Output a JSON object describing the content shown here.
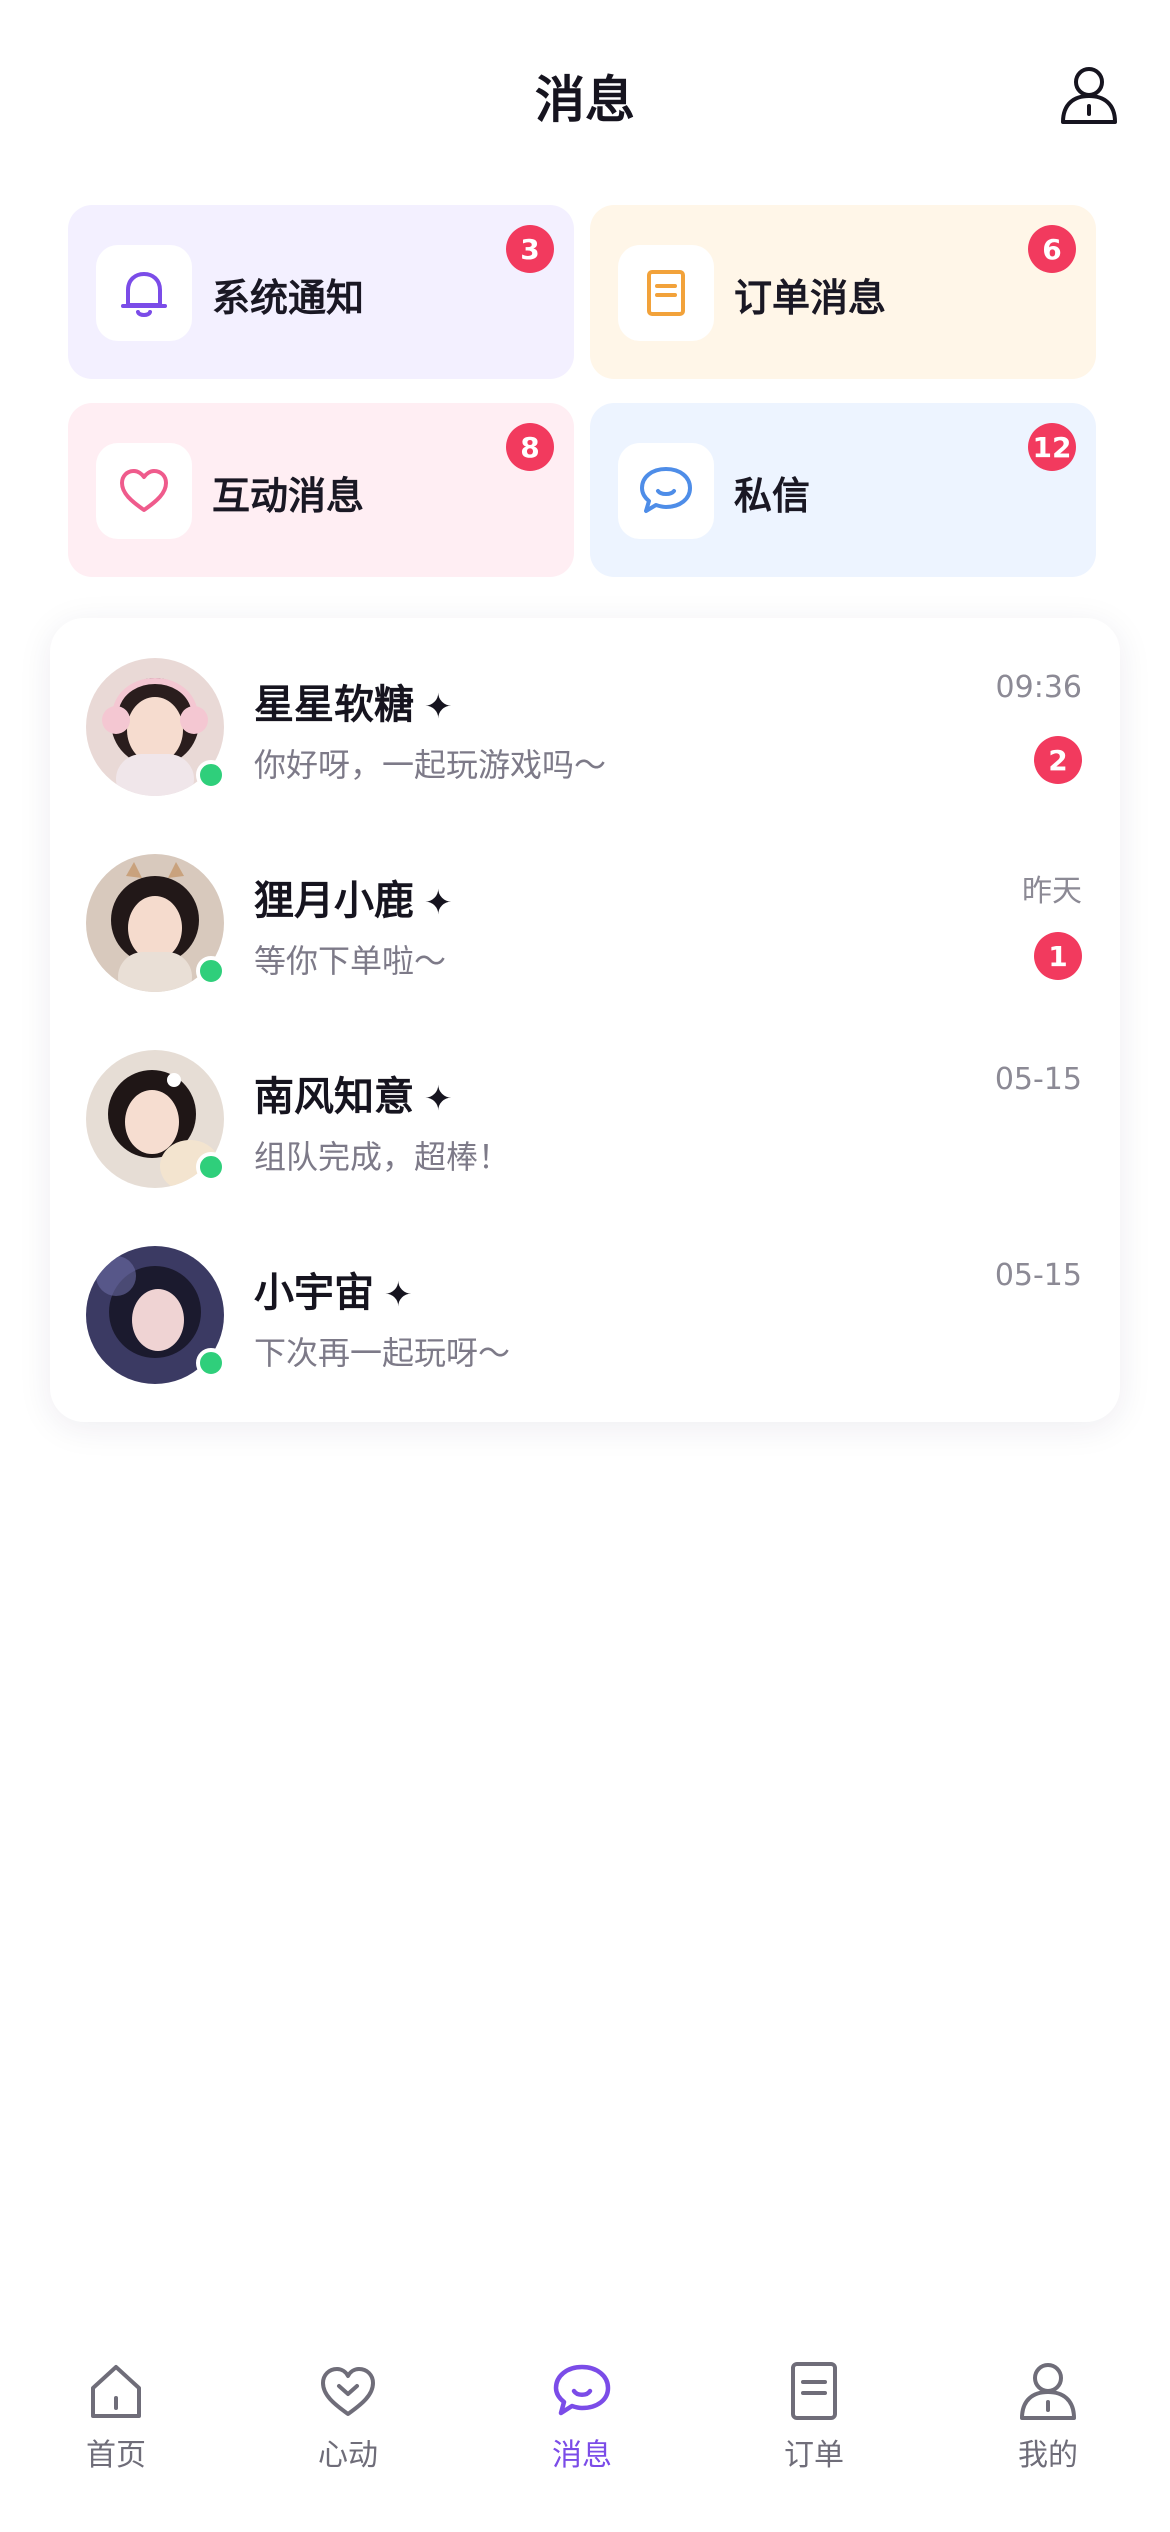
{
  "header": {
    "title": "消息",
    "profile_icon": "user-outline-icon"
  },
  "categories": [
    {
      "label": "系统通知",
      "badge": "3",
      "icon": "bell-icon",
      "bg": "#f3f0ff",
      "color": "#7b4ce8"
    },
    {
      "label": "订单消息",
      "badge": "6",
      "icon": "document-icon",
      "bg": "#fff6e8",
      "color": "#f2a23a"
    },
    {
      "label": "互动消息",
      "badge": "8",
      "icon": "heart-icon",
      "bg": "#ffeef3",
      "color": "#ef5b8c"
    },
    {
      "label": "私信",
      "badge": "12",
      "icon": "chat-bubble-icon",
      "bg": "#edf4ff",
      "color": "#4e8de8"
    }
  ],
  "conversations": [
    {
      "name": "星星软糖",
      "sparkle": "✦",
      "preview": "你好呀，一起玩游戏吗～",
      "time": "09:36",
      "unread": "2",
      "online": true
    },
    {
      "name": "狸月小鹿",
      "sparkle": "✦",
      "preview": "等你下单啦～",
      "time": "昨天",
      "unread": "1",
      "online": true
    },
    {
      "name": "南风知意",
      "sparkle": "✦",
      "preview": "组队完成，超棒！",
      "time": "05-15",
      "unread": "",
      "online": true
    },
    {
      "name": "小宇宙",
      "sparkle": "✦",
      "preview": "下次再一起玩呀～",
      "time": "05-15",
      "unread": "",
      "online": true
    }
  ],
  "tabbar": {
    "items": [
      {
        "label": "首页",
        "icon": "home-icon",
        "active": false
      },
      {
        "label": "心动",
        "icon": "heart-icon",
        "active": false
      },
      {
        "label": "消息",
        "icon": "chat-bubble-icon",
        "active": true
      },
      {
        "label": "订单",
        "icon": "document-icon",
        "active": false
      },
      {
        "label": "我的",
        "icon": "user-icon",
        "active": false
      }
    ]
  },
  "colors": {
    "accent": "#7b4ce8",
    "badge": "#f23a5e",
    "online": "#2fcf7b"
  }
}
